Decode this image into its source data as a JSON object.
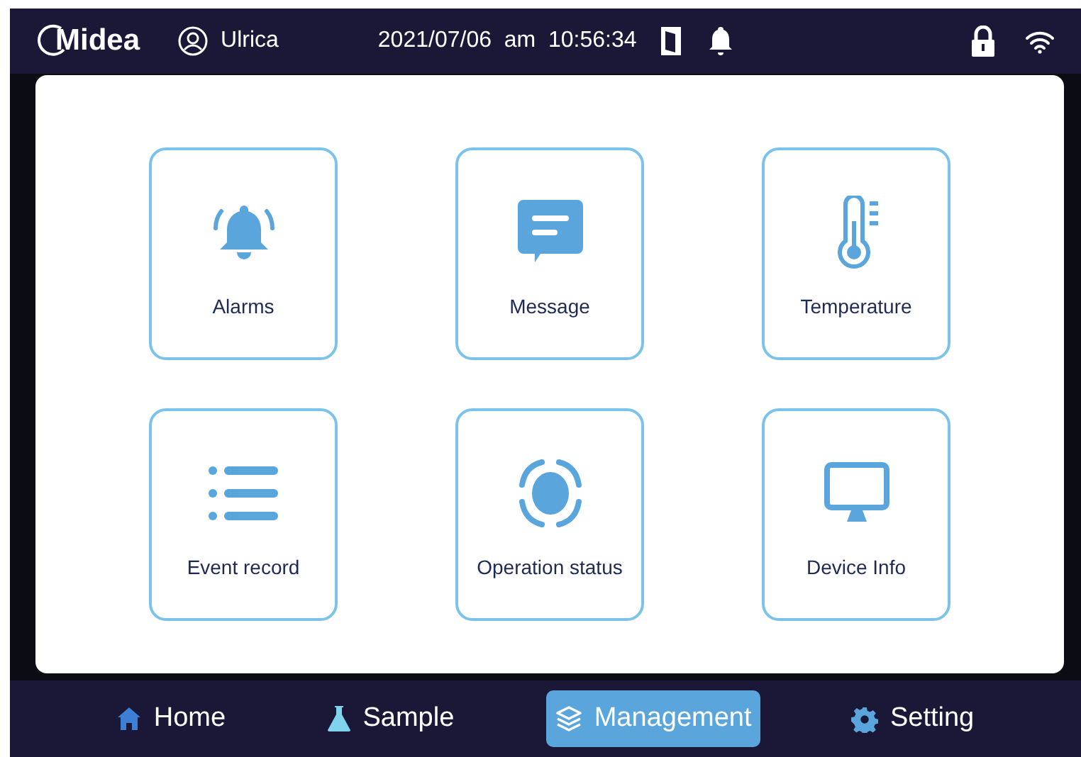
{
  "status_bar": {
    "logo": "Midea",
    "user": "Ulrica",
    "datetime": "2021/07/06  am  10:56:34"
  },
  "tiles": [
    {
      "label": "Alarms",
      "kind": "bell"
    },
    {
      "label": "Message",
      "kind": "message"
    },
    {
      "label": "Temperature",
      "kind": "thermometer"
    },
    {
      "label": "Event record",
      "kind": "list"
    },
    {
      "label": "Operation status",
      "kind": "status"
    },
    {
      "label": "Device Info",
      "kind": "monitor"
    }
  ],
  "nav": [
    {
      "label": "Home",
      "kind": "home",
      "selected": false
    },
    {
      "label": "Sample",
      "kind": "flask",
      "selected": false
    },
    {
      "label": "Management",
      "kind": "layers",
      "selected": true
    },
    {
      "label": "Setting",
      "kind": "gear",
      "selected": false
    }
  ]
}
